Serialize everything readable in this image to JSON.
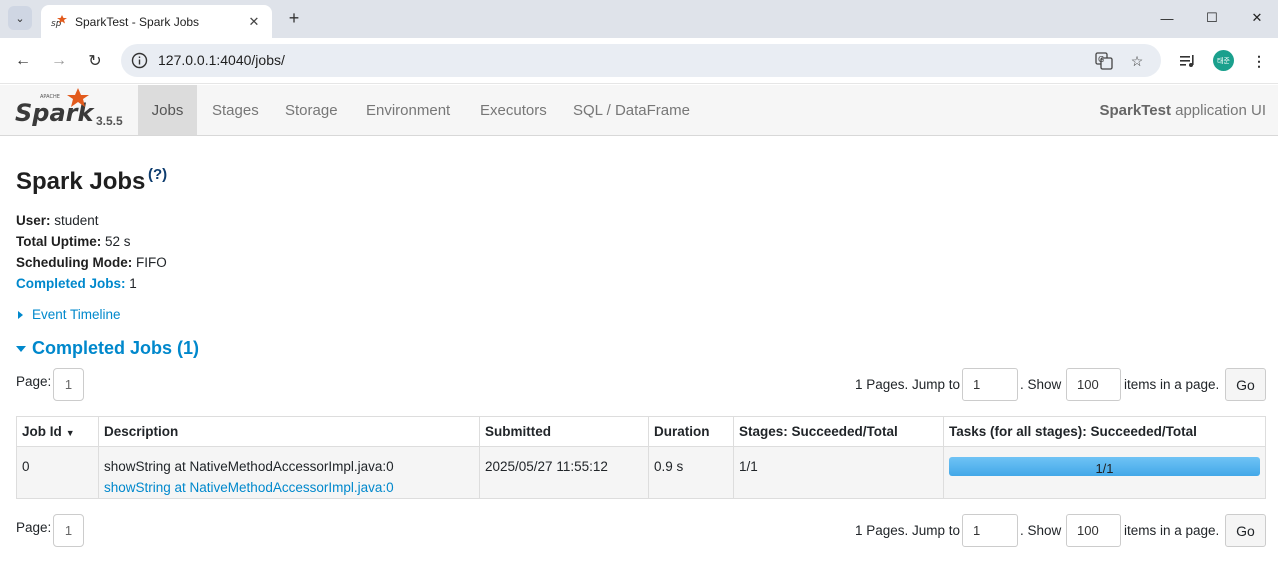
{
  "browser": {
    "tab_title": "SparkTest - Spark Jobs",
    "url": "127.0.0.1:4040/jobs/",
    "profile_initials": "태준"
  },
  "spark": {
    "logo_text": "Spark",
    "logo_apache": "APACHE",
    "version": "3.5.5",
    "nav_tabs": [
      {
        "label": "Jobs",
        "active": true
      },
      {
        "label": "Stages",
        "active": false
      },
      {
        "label": "Storage",
        "active": false
      },
      {
        "label": "Environment",
        "active": false
      },
      {
        "label": "Executors",
        "active": false
      },
      {
        "label": "SQL / DataFrame",
        "active": false
      }
    ],
    "app_name": "SparkTest",
    "app_suffix": " application UI"
  },
  "page": {
    "title": "Spark Jobs",
    "help": "(?)",
    "user_label": "User:",
    "user": " student",
    "uptime_label": "Total Uptime:",
    "uptime": " 52 s",
    "mode_label": "Scheduling Mode:",
    "mode": " FIFO",
    "completed_label": "Completed Jobs:",
    "completed": " 1",
    "event_timeline": "Event Timeline",
    "section_title": "Completed Jobs (1)"
  },
  "pager": {
    "page_label": "Page:",
    "page_value": "1",
    "pages_text": "1 Pages. Jump to",
    "jump_value": "1",
    "show_text": ". Show",
    "show_value": "100",
    "items_text": "items in a page.",
    "go_label": "Go"
  },
  "table": {
    "headers": [
      "Job Id",
      "Description",
      "Submitted",
      "Duration",
      "Stages: Succeeded/Total",
      "Tasks (for all stages): Succeeded/Total"
    ],
    "sort_indicator": "▼",
    "rows": [
      {
        "job_id": "0",
        "description": "showString at NativeMethodAccessorImpl.java:0",
        "description_link": "showString at NativeMethodAccessorImpl.java:0",
        "submitted": "2025/05/27 11:55:12",
        "duration": "0.9 s",
        "stages": "1/1",
        "tasks": "1/1",
        "tasks_progress": 1.0
      }
    ]
  }
}
